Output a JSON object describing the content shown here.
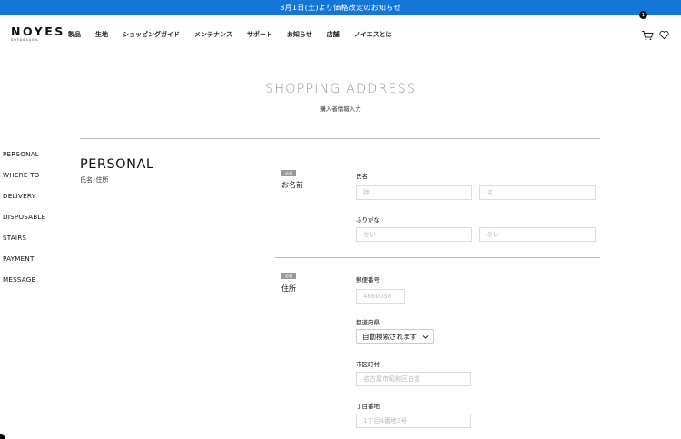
{
  "banner": {
    "text": "8月1日(土)より価格改定のお知らせ"
  },
  "header": {
    "logo": "NOYES",
    "logo_sub": "SOFA&100%",
    "nav": [
      "製品",
      "生地",
      "ショッピングガイド",
      "メンテナンス",
      "サポート",
      "お知らせ",
      "店舗",
      "ノイエスとは"
    ],
    "cart_count": "1",
    "icons": {
      "cart": "cart-icon",
      "wishlist": "heart-icon"
    }
  },
  "page": {
    "title": "SHOPPING ADDRESS",
    "subtitle": "購入者情報入力"
  },
  "side_nav": [
    "PERSONAL",
    "WHERE TO",
    "DELIVERY",
    "DISPOSABLE",
    "STAIRS",
    "PAYMENT",
    "MESSAGE"
  ],
  "section": {
    "heading": "PERSONAL",
    "sub": "氏名･住所"
  },
  "groups": {
    "name": {
      "badge": "必須",
      "label": "お名前"
    },
    "address": {
      "badge": "必須",
      "label": "住所"
    }
  },
  "fields": {
    "full_name": {
      "label": "氏名",
      "last_placeholder": "姓",
      "first_placeholder": "名"
    },
    "furigana": {
      "label": "ふりがな",
      "last_placeholder": "せい",
      "first_placeholder": "めい"
    },
    "postal": {
      "label": "郵便番号",
      "placeholder": "4660058"
    },
    "prefecture": {
      "label": "都道府県",
      "selected": "自動検索されます"
    },
    "city": {
      "label": "市区町村",
      "placeholder": "名古屋市昭和区白金"
    },
    "block": {
      "label": "丁目番地",
      "placeholder": "1丁目4番地3号"
    }
  },
  "colors": {
    "banner": "#1476d6",
    "badge": "#999999",
    "title": "#999999"
  }
}
